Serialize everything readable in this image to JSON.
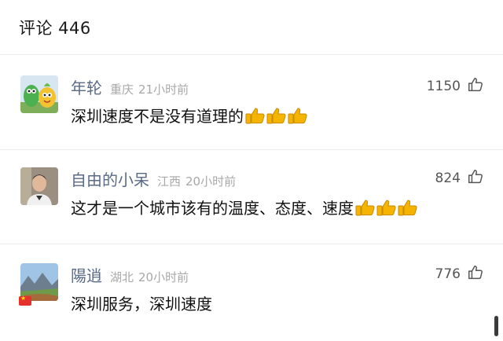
{
  "header": {
    "title": "评论 446"
  },
  "comments": [
    {
      "username": "年轮",
      "location": "重庆",
      "time": "21小时前",
      "likes": "1150",
      "text": "深圳速度不是没有道理的",
      "emoji": [
        "thumbs-up-icon",
        "thumbs-up-icon",
        "thumbs-up-icon"
      ],
      "avatar": "fruit-cartoon-avatar"
    },
    {
      "username": "自由的小呆",
      "location": "江西",
      "time": "20小时前",
      "likes": "824",
      "text": "这才是一个城市该有的温度、态度、速度",
      "emoji": [
        "thumbs-up-icon",
        "thumbs-up-icon",
        "thumbs-up-icon"
      ],
      "avatar": "person-photo-avatar"
    },
    {
      "username": "陽逍",
      "location": "湖北",
      "time": "20小时前",
      "likes": "776",
      "text": "深圳服务，深圳速度",
      "emoji": [],
      "avatar": "landscape-avatar",
      "flag": "china-flag-icon"
    }
  ],
  "colors": {
    "username": "#5a6a85",
    "meta": "#a8a8a8",
    "text": "#111111",
    "divider": "#ececec",
    "emoji_yellow": "#f4b400"
  }
}
